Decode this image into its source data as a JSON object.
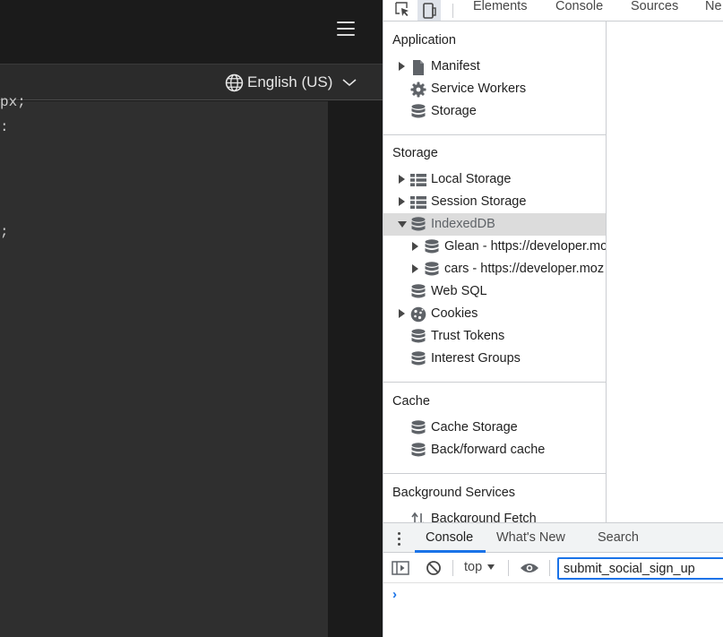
{
  "page": {
    "language_label": "English (US)",
    "code_lines": [
      {
        "text": "px;"
      },
      {
        "text": ":"
      },
      {
        "text": ";"
      }
    ]
  },
  "devtools": {
    "tabs": [
      "Elements",
      "Console",
      "Sources",
      "Ne"
    ],
    "sections": {
      "application": {
        "title": "Application",
        "items": [
          {
            "label": "Manifest",
            "icon": "document-icon",
            "expandable": true
          },
          {
            "label": "Service Workers",
            "icon": "gear-icon",
            "expandable": false
          },
          {
            "label": "Storage",
            "icon": "database-icon",
            "expandable": false
          }
        ]
      },
      "storage": {
        "title": "Storage",
        "items": [
          {
            "label": "Local Storage",
            "icon": "grid-icon",
            "expandable": true
          },
          {
            "label": "Session Storage",
            "icon": "grid-icon",
            "expandable": true
          },
          {
            "label": "IndexedDB",
            "icon": "database-icon",
            "expanded": true,
            "selected": true
          },
          {
            "label": "Glean - https://developer.mo",
            "icon": "database-icon",
            "expandable": true,
            "child": true
          },
          {
            "label": "cars - https://developer.moz",
            "icon": "database-icon",
            "expandable": true,
            "child": true
          },
          {
            "label": "Web SQL",
            "icon": "database-icon",
            "expandable": false
          },
          {
            "label": "Cookies",
            "icon": "cookie-icon",
            "expandable": true
          },
          {
            "label": "Trust Tokens",
            "icon": "database-icon",
            "expandable": false
          },
          {
            "label": "Interest Groups",
            "icon": "database-icon",
            "expandable": false
          }
        ]
      },
      "cache": {
        "title": "Cache",
        "items": [
          {
            "label": "Cache Storage",
            "icon": "database-icon"
          },
          {
            "label": "Back/forward cache",
            "icon": "database-icon"
          }
        ]
      },
      "background": {
        "title": "Background Services",
        "items": [
          {
            "label": "Background Fetch",
            "icon": "sync-arrows-icon"
          }
        ]
      }
    },
    "drawer": {
      "tabs": [
        "Console",
        "What's New",
        "Search"
      ],
      "active_tab": "Console",
      "context": "top",
      "filter_value": "submit_social_sign_up",
      "prompt": "›"
    },
    "colors": {
      "accent": "#1a73e8",
      "selected_row": "#dcdcdc"
    }
  }
}
